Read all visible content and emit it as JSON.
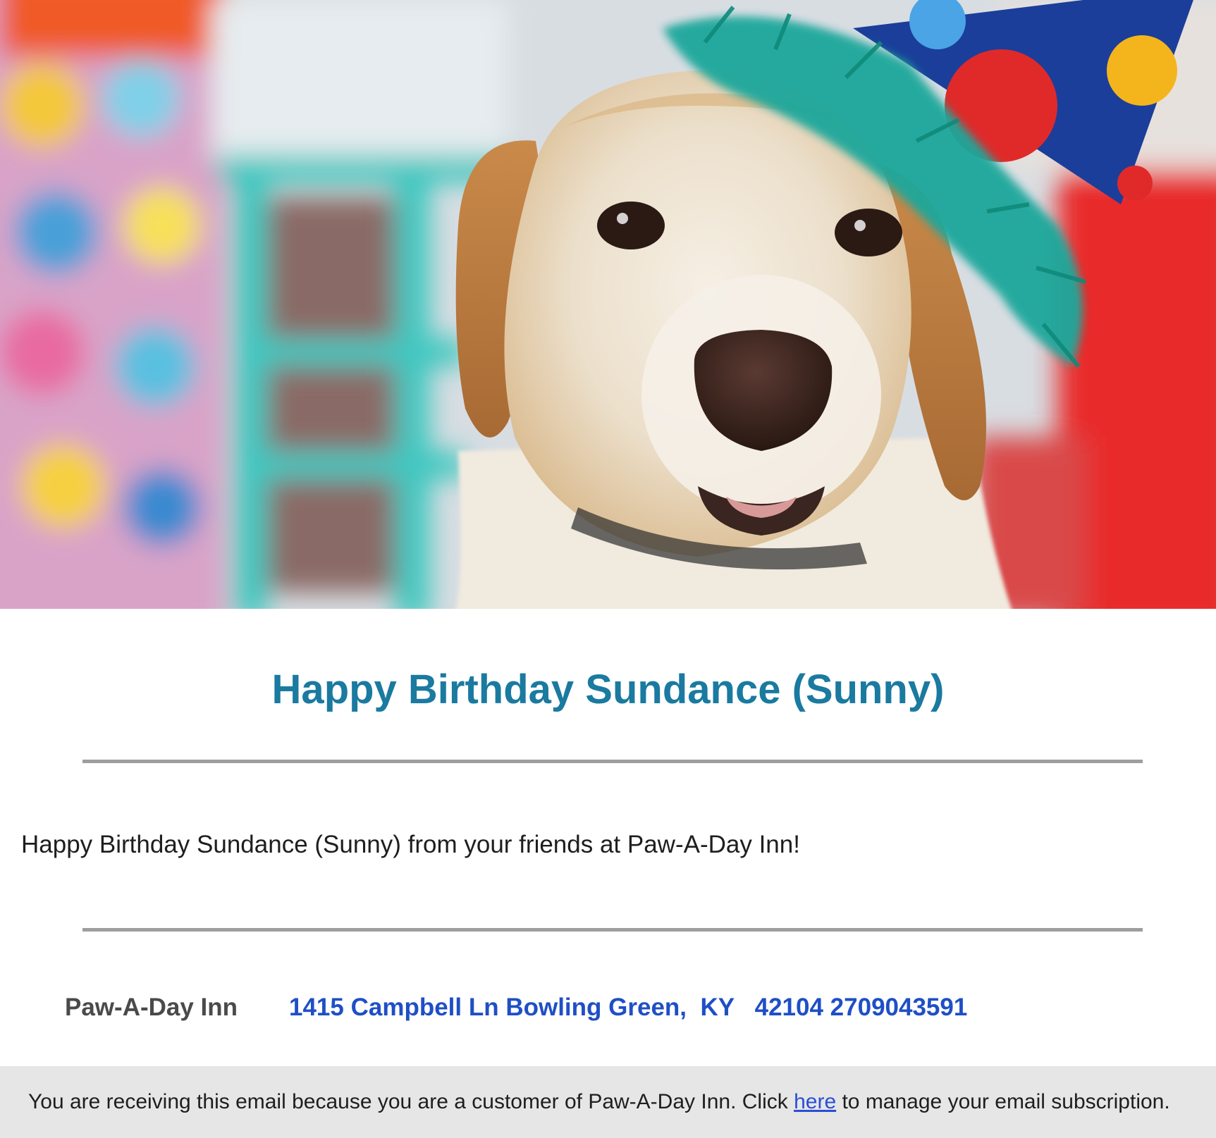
{
  "hero": {
    "alt": "Dog wearing a colorful party hat"
  },
  "title": "Happy Birthday Sundance (Sunny)",
  "message": "Happy Birthday Sundance (Sunny) from your friends at Paw-A-Day Inn!",
  "business": {
    "name": "Paw-A-Day Inn",
    "address_line": "1415 Campbell Ln Bowling Green,  KY   42104 2709043591"
  },
  "subscription": {
    "before": "You are receiving this email because you are a customer of Paw-A-Day Inn. Click ",
    "link_text": "here",
    "after": " to manage your email subscription."
  },
  "colors": {
    "title": "#1a7aa0",
    "address_link": "#1f4fc6",
    "business_name": "#4a4a4a",
    "rule": "#9e9e9e",
    "footer_bg": "#e6e6e6"
  }
}
